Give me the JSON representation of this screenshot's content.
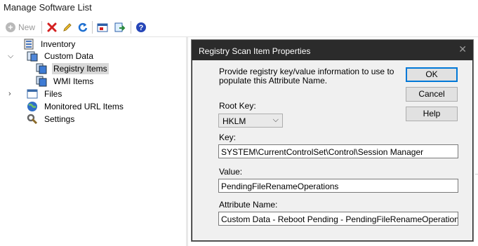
{
  "window": {
    "title": "Manage Software List"
  },
  "toolbar": {
    "new_label": "New",
    "buttons": [
      {
        "icon": "delete-icon",
        "color": "#d42020"
      },
      {
        "icon": "edit-icon",
        "color": "#c99a14"
      },
      {
        "icon": "refresh-icon",
        "color": "#1e6fd0"
      },
      {
        "icon": "export-icon",
        "color": "#2d5fa8"
      },
      {
        "icon": "import-icon",
        "color": "#2a8a3a"
      },
      {
        "icon": "help-icon",
        "color": "#2646b8"
      }
    ]
  },
  "tree": {
    "items": [
      {
        "label": "Inventory",
        "icon": "inventory-icon"
      },
      {
        "label": "Custom Data",
        "icon": "custom-data-icon",
        "expanded": true
      },
      {
        "label": "Registry Items",
        "icon": "registry-icon",
        "selected": true
      },
      {
        "label": "WMI Items",
        "icon": "wmi-icon"
      },
      {
        "label": "Files",
        "icon": "folder-icon",
        "expanded": false
      },
      {
        "label": "Monitored URL Items",
        "icon": "globe-icon"
      },
      {
        "label": "Settings",
        "icon": "settings-icon"
      }
    ]
  },
  "dialog": {
    "title": "Registry Scan Item Properties",
    "intro": "Provide registry key/value information to use to populate this Attribute Name.",
    "root_key": {
      "label": "Root Key:",
      "value": "HKLM"
    },
    "key": {
      "label": "Key:",
      "value": "SYSTEM\\CurrentControlSet\\Control\\Session Manager"
    },
    "value": {
      "label": "Value:",
      "value": "PendingFileRenameOperations"
    },
    "attribute_name": {
      "label": "Attribute Name:",
      "value": "Custom Data - Reboot Pending - PendingFileRenameOperations"
    },
    "buttons": {
      "ok": "OK",
      "cancel": "Cancel",
      "help": "Help"
    }
  }
}
